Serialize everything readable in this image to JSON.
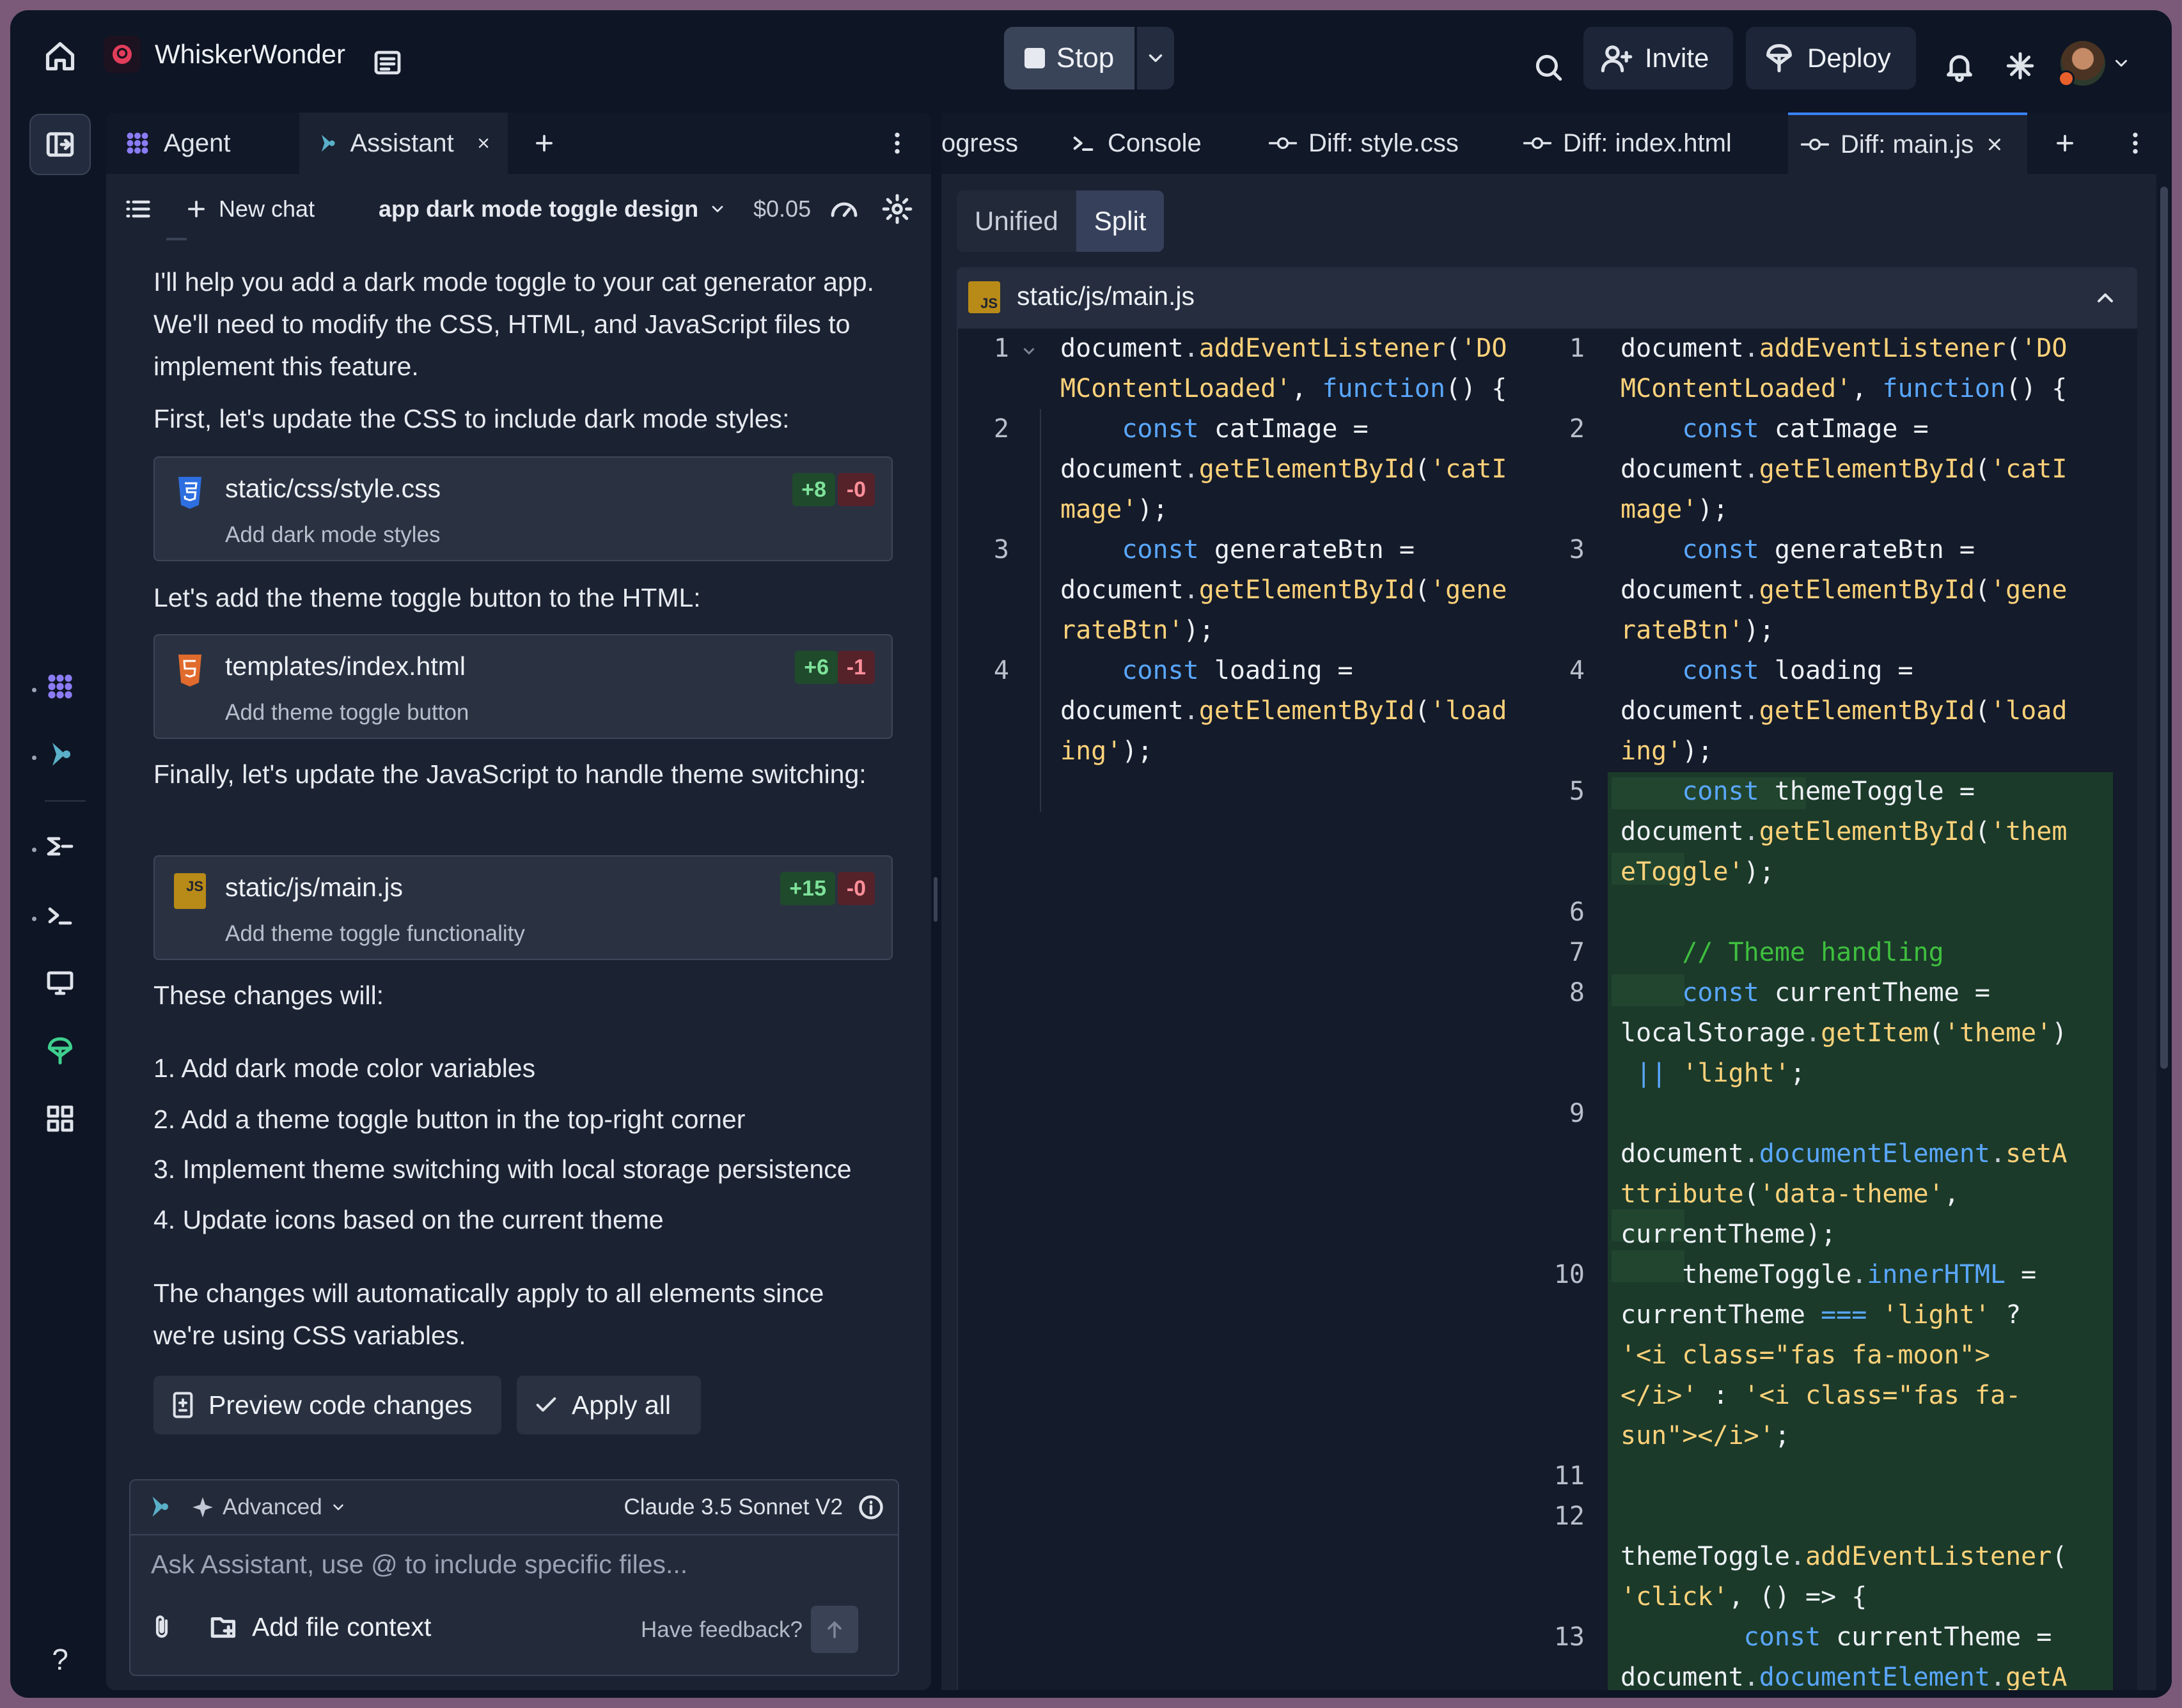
{
  "app": {
    "title": "WhiskerWonder",
    "stop_label": "Stop",
    "invite_label": "Invite",
    "deploy_label": "Deploy"
  },
  "left_pane": {
    "tabs": [
      {
        "label": "Agent",
        "icon": "agent-icon"
      },
      {
        "label": "Assistant",
        "icon": "assistant-icon",
        "active": true
      }
    ],
    "chatbar": {
      "new_chat": "New chat",
      "chat_title": "app dark mode toggle design",
      "cost": "$0.05"
    },
    "messages": {
      "intro": "I'll help you add a dark mode toggle to your cat generator app. We'll need to modify the CSS, HTML, and JavaScript files to implement this feature.",
      "css_intro": "First, let's update the CSS to include dark mode styles:",
      "html_intro": "Let's add the theme toggle button to the HTML:",
      "js_intro": "Finally, let's update the JavaScript to handle theme switching:",
      "changes_intro": "These changes will:",
      "changes": [
        "1. Add dark mode color variables",
        "2. Add a theme toggle button in the top-right corner",
        "3. Implement theme switching with local storage persistence",
        "4. Update icons based on the current theme"
      ],
      "outro": "The changes will automatically apply to all elements since we're using CSS variables."
    },
    "files": [
      {
        "name": "static/css/style.css",
        "desc": "Add dark mode styles",
        "added": "+8",
        "removed": "-0",
        "icon": "css-file-icon"
      },
      {
        "name": "templates/index.html",
        "desc": "Add theme toggle button",
        "added": "+6",
        "removed": "-1",
        "icon": "html-file-icon"
      },
      {
        "name": "static/js/main.js",
        "desc": "Add theme toggle functionality",
        "added": "+15",
        "removed": "-0",
        "icon": "js-file-icon"
      }
    ],
    "actions": {
      "preview": "Preview code changes",
      "apply": "Apply all"
    },
    "composer": {
      "mode": "Advanced",
      "model": "Claude 3.5 Sonnet V2",
      "placeholder": "Ask Assistant, use @ to include specific files...",
      "add_file": "Add file context",
      "feedback": "Have feedback?"
    }
  },
  "right_pane": {
    "tabs": [
      {
        "label": "ogress"
      },
      {
        "label": "Console"
      },
      {
        "label": "Diff: style.css"
      },
      {
        "label": "Diff: index.html"
      },
      {
        "label": "Diff: main.js",
        "active": true
      }
    ],
    "view_modes": [
      "Unified",
      "Split"
    ],
    "active_view": "Split",
    "file_path": "static/js/main.js",
    "js_badge": "JS",
    "left_line_numbers": [
      "1",
      "2",
      "3",
      "4"
    ],
    "right_line_numbers": [
      "1",
      "2",
      "3",
      "4",
      "5",
      "6",
      "7",
      "8",
      "9",
      "10",
      "11",
      "12",
      "13"
    ]
  },
  "colors": {
    "accent": "#3b82f6",
    "added_bg": "#1b3a2a",
    "keyword": "#5aa7ff",
    "string": "#ffd27a",
    "comment": "#3fbf3f"
  }
}
